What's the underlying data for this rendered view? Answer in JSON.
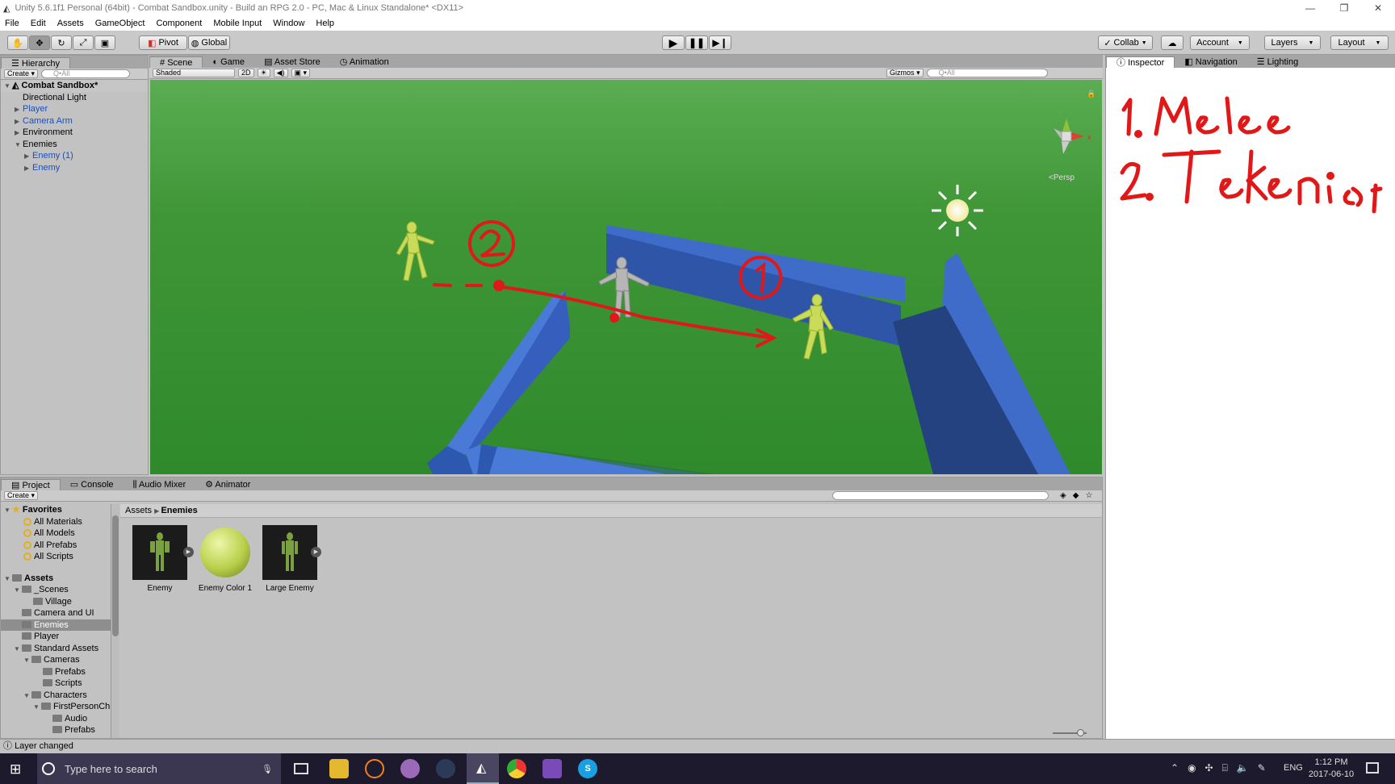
{
  "window": {
    "title": "Unity 5.6.1f1 Personal (64bit) - Combat Sandbox.unity - Build an RPG 2.0 - PC, Mac & Linux Standalone* <DX11>"
  },
  "menu": [
    "File",
    "Edit",
    "Assets",
    "GameObject",
    "Component",
    "Mobile Input",
    "Window",
    "Help"
  ],
  "toolbar": {
    "pivot": "Pivot",
    "global": "Global",
    "collab": "Collab",
    "account": "Account",
    "layers": "Layers",
    "layout": "Layout"
  },
  "hierarchy": {
    "tab": "Hierarchy",
    "create": "Create",
    "search": "Q•All",
    "scene": "Combat Sandbox*",
    "items": [
      "Directional Light",
      "Player",
      "Camera Arm",
      "Environment",
      "Enemies",
      "Enemy (1)",
      "Enemy"
    ]
  },
  "scene_tabs": {
    "scene": "Scene",
    "game": "Game",
    "asset_store": "Asset Store",
    "animation": "Animation"
  },
  "scene_bar": {
    "shading": "Shaded",
    "mode_2d": "2D",
    "gizmos": "Gizmos",
    "search": "Q•All"
  },
  "scene_view": {
    "persp": "<Persp",
    "gizmo_y": "y",
    "gizmo_x": "x"
  },
  "inspector_tabs": {
    "inspector": "Inspector",
    "navigation": "Navigation",
    "lighting": "Lighting"
  },
  "project": {
    "tabs": {
      "project": "Project",
      "console": "Console",
      "audio_mixer": "Audio Mixer",
      "animator": "Animator"
    },
    "create": "Create",
    "favorites_label": "Favorites",
    "favorites": [
      "All Materials",
      "All Models",
      "All Prefabs",
      "All Scripts"
    ],
    "assets_label": "Assets",
    "tree": [
      "_Scenes",
      "Village",
      "Camera and UI",
      "Enemies",
      "Player",
      "Standard Assets",
      "Cameras",
      "Prefabs",
      "Scripts",
      "Characters",
      "FirstPersonCh",
      "Audio",
      "Prefabs"
    ],
    "breadcrumb": [
      "Assets",
      "Enemies"
    ],
    "assets": [
      {
        "name": "Enemy"
      },
      {
        "name": "Enemy Color 1"
      },
      {
        "name": "Large Enemy"
      }
    ]
  },
  "status": {
    "message": "Layer changed"
  },
  "taskbar": {
    "search_placeholder": "Type here to search",
    "lang": "ENG",
    "time": "1:12 PM",
    "date": "2017-06-10"
  },
  "colors": {
    "ground": "#3a8f32",
    "wall": "#4a7ad8",
    "annotation": "#e01818",
    "enemy": "#c8dc5a"
  }
}
